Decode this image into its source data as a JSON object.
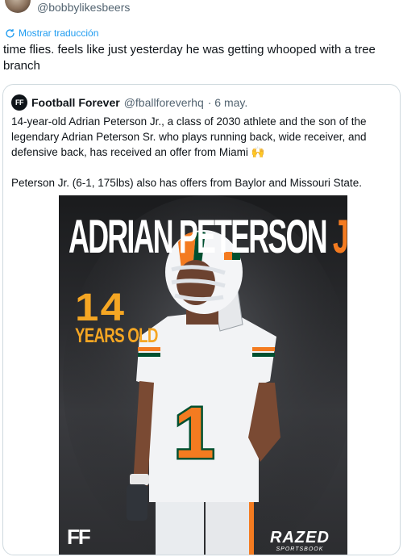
{
  "tweet": {
    "handle": "@bobbylikesbeers",
    "translate_label": "Mostrar traducción",
    "text": "time flies. feels like just yesterday he was getting whooped with a tree branch"
  },
  "quote": {
    "avatar_text": "FF",
    "name": "Football Forever",
    "handle": "@fballforeverhq",
    "date": "· 6 may.",
    "paragraph1": "14-year-old Adrian Peterson Jr., a class of 2030 athlete and the son of the legendary Adrian Peterson Sr. who plays running back, wide receiver, and defensive back, has received an offer from Miami 🙌",
    "paragraph2": "Peterson Jr. (6-1, 175lbs) also has offers from Baylor and Missouri State."
  },
  "graphic": {
    "title_main": "ADRIAN PETERSON",
    "title_suffix": "JR",
    "age_number": "14",
    "age_label": "YEARS OLD",
    "jersey_number": "1",
    "logo_text": "FF",
    "sponsor_main": "RAZED",
    "sponsor_sub": "SPORTSBOOK"
  },
  "colors": {
    "link_blue": "#1d9bf0",
    "miami_orange": "#f47b20",
    "miami_green": "#005030",
    "age_gold": "#f5a623"
  },
  "icons": {
    "translate": "translate-icon",
    "verified_logo": "ff-logo"
  }
}
